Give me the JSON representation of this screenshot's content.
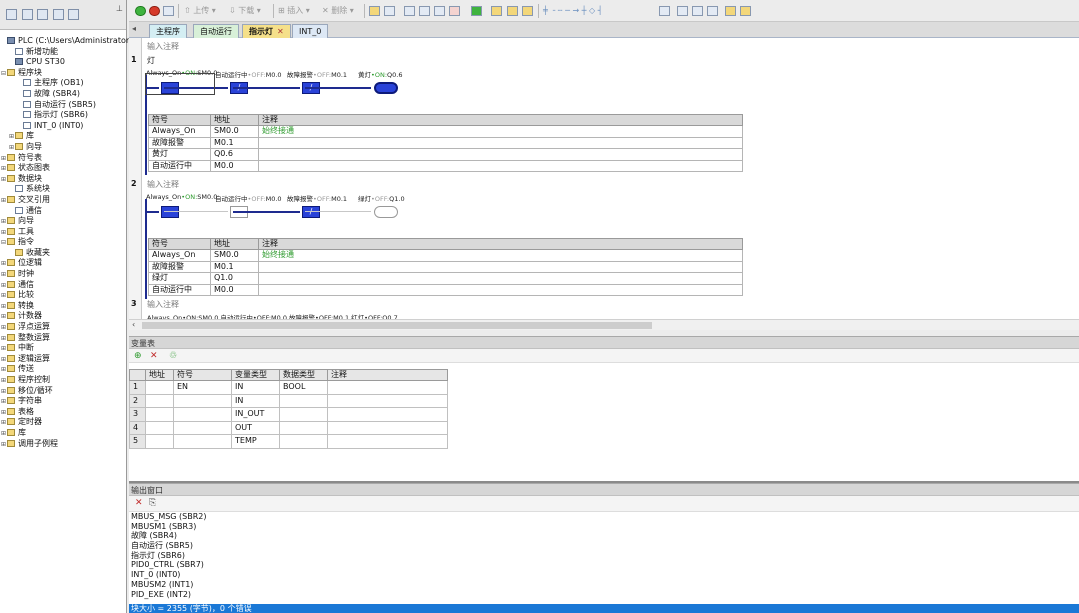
{
  "left_toolbar": {
    "first": "",
    "pin": ""
  },
  "tree": [
    {
      "indent": 0,
      "exp": "",
      "icon": "cpu",
      "label": "PLC (C:\\Users\\Administrator\\Deskt"
    },
    {
      "indent": 1,
      "exp": "",
      "icon": "doc",
      "label": "新增功能"
    },
    {
      "indent": 1,
      "exp": "",
      "icon": "cpu",
      "label": "CPU ST30"
    },
    {
      "indent": 0,
      "exp": "⊟",
      "icon": "folder",
      "label": "程序块"
    },
    {
      "indent": 2,
      "exp": "",
      "icon": "doc",
      "label": "主程序 (OB1)"
    },
    {
      "indent": 2,
      "exp": "",
      "icon": "doc",
      "label": "故障 (SBR4)"
    },
    {
      "indent": 2,
      "exp": "",
      "icon": "doc",
      "label": "自动运行 (SBR5)"
    },
    {
      "indent": 2,
      "exp": "",
      "icon": "doc",
      "label": "指示灯 (SBR6)"
    },
    {
      "indent": 2,
      "exp": "",
      "icon": "doc",
      "label": "INT_0 (INT0)"
    },
    {
      "indent": 1,
      "exp": "⊞",
      "icon": "folder",
      "label": "库"
    },
    {
      "indent": 1,
      "exp": "⊞",
      "icon": "folder",
      "label": "向导"
    },
    {
      "indent": 0,
      "exp": "⊞",
      "icon": "folder",
      "label": "符号表"
    },
    {
      "indent": 0,
      "exp": "⊞",
      "icon": "folder",
      "label": "状态图表"
    },
    {
      "indent": 0,
      "exp": "⊞",
      "icon": "folder",
      "label": "数据块"
    },
    {
      "indent": 1,
      "exp": "",
      "icon": "doc",
      "label": "系统块"
    },
    {
      "indent": 0,
      "exp": "⊞",
      "icon": "folder",
      "label": "交叉引用"
    },
    {
      "indent": 1,
      "exp": "",
      "icon": "doc",
      "label": "通信"
    },
    {
      "indent": 0,
      "exp": "⊞",
      "icon": "folder",
      "label": "向导"
    },
    {
      "indent": 0,
      "exp": "⊞",
      "icon": "folder",
      "label": "工具"
    },
    {
      "indent": 0,
      "exp": "⊟",
      "icon": "folder",
      "label": "指令"
    },
    {
      "indent": 1,
      "exp": "",
      "icon": "folder",
      "label": "收藏夹"
    },
    {
      "indent": 0,
      "exp": "⊞",
      "icon": "folder",
      "label": "位逻辑"
    },
    {
      "indent": 0,
      "exp": "⊞",
      "icon": "folder",
      "label": "时钟"
    },
    {
      "indent": 0,
      "exp": "⊞",
      "icon": "folder",
      "label": "通信"
    },
    {
      "indent": 0,
      "exp": "⊞",
      "icon": "folder",
      "label": "比较"
    },
    {
      "indent": 0,
      "exp": "⊞",
      "icon": "folder",
      "label": "转换"
    },
    {
      "indent": 0,
      "exp": "⊞",
      "icon": "folder",
      "label": "计数器"
    },
    {
      "indent": 0,
      "exp": "⊞",
      "icon": "folder",
      "label": "浮点运算"
    },
    {
      "indent": 0,
      "exp": "⊞",
      "icon": "folder",
      "label": "整数运算"
    },
    {
      "indent": 0,
      "exp": "⊞",
      "icon": "folder",
      "label": "中断"
    },
    {
      "indent": 0,
      "exp": "⊞",
      "icon": "folder",
      "label": "逻辑运算"
    },
    {
      "indent": 0,
      "exp": "⊞",
      "icon": "folder",
      "label": "传送"
    },
    {
      "indent": 0,
      "exp": "⊞",
      "icon": "folder",
      "label": "程序控制"
    },
    {
      "indent": 0,
      "exp": "⊞",
      "icon": "folder",
      "label": "移位/循环"
    },
    {
      "indent": 0,
      "exp": "⊞",
      "icon": "folder",
      "label": "字符串"
    },
    {
      "indent": 0,
      "exp": "⊞",
      "icon": "folder",
      "label": "表格"
    },
    {
      "indent": 0,
      "exp": "⊞",
      "icon": "folder",
      "label": "定时器"
    },
    {
      "indent": 0,
      "exp": "⊞",
      "icon": "folder",
      "label": "库"
    },
    {
      "indent": 0,
      "exp": "⊞",
      "icon": "folder",
      "label": "调用子例程"
    }
  ],
  "toolbar": {
    "upload": "上传",
    "download": "下载",
    "insert": "插入",
    "delete": "删除"
  },
  "tabs": [
    {
      "label": "主程序",
      "style": "t-main"
    },
    {
      "label": "自动运行",
      "style": "t-auto"
    },
    {
      "label": "指示灯",
      "style": "t-ind",
      "close": "✕"
    },
    {
      "label": "INT_0",
      "style": "t-int"
    }
  ],
  "editor": {
    "header_comment": "输入注释",
    "networks": [
      {
        "number": "1",
        "title": "灯",
        "comment": "",
        "contacts": [
          {
            "symbol": "Always_On",
            "state": "ON",
            "addr": "SM0.0",
            "type": "NO",
            "active": true
          },
          {
            "symbol": "自动运行中",
            "state": "OFF",
            "addr": "M0.0",
            "type": "NC",
            "active": true
          },
          {
            "symbol": "故障报警",
            "state": "OFF",
            "addr": "M0.1",
            "type": "NC",
            "active": true
          },
          {
            "symbol": "黄灯",
            "state": "ON",
            "addr": "Q0.6",
            "type": "COIL",
            "active": true
          }
        ],
        "table": [
          [
            "Always_On",
            "SM0.0",
            "始终接通"
          ],
          [
            "故障报警",
            "M0.1",
            ""
          ],
          [
            "黄灯",
            "Q0.6",
            ""
          ],
          [
            "自动运行中",
            "M0.0",
            ""
          ]
        ]
      },
      {
        "number": "2",
        "title": "",
        "comment": "输入注释",
        "contacts": [
          {
            "symbol": "Always_On",
            "state": "ON",
            "addr": "SM0.0",
            "type": "NO",
            "active": true
          },
          {
            "symbol": "自动运行中",
            "state": "OFF",
            "addr": "M0.0",
            "type": "NO",
            "active": false
          },
          {
            "symbol": "故障报警",
            "state": "OFF",
            "addr": "M0.1",
            "type": "NC",
            "active": true
          },
          {
            "symbol": "绿灯",
            "state": "OFF",
            "addr": "Q1.0",
            "type": "COIL",
            "active": false
          }
        ],
        "table": [
          [
            "Always_On",
            "SM0.0",
            "始终接通"
          ],
          [
            "故障报警",
            "M0.1",
            ""
          ],
          [
            "绿灯",
            "Q1.0",
            ""
          ],
          [
            "自动运行中",
            "M0.0",
            ""
          ]
        ]
      },
      {
        "number": "3",
        "comment": "输入注释",
        "partial": "Always_On•ON:SM0.0   自动运行中•OFF:M0.0   故障报警•OFF:M0.1   红灯•OFF:Q0.7"
      }
    ],
    "table_headers": [
      "符号",
      "地址",
      "注释"
    ]
  },
  "var_panel": {
    "title": "变量表",
    "headers": [
      "",
      "地址",
      "符号",
      "变量类型",
      "数据类型",
      "注释"
    ],
    "rows": [
      [
        "1",
        "",
        "EN",
        "IN",
        "BOOL",
        ""
      ],
      [
        "2",
        "",
        "",
        "IN",
        "",
        ""
      ],
      [
        "3",
        "",
        "",
        "IN_OUT",
        "",
        ""
      ],
      [
        "4",
        "",
        "",
        "OUT",
        "",
        ""
      ],
      [
        "5",
        "",
        "",
        "TEMP",
        "",
        ""
      ]
    ]
  },
  "output_panel": {
    "title": "输出窗口",
    "lines": [
      "MBUS_MSG (SBR2)",
      "MBUSM1 (SBR3)",
      "故障 (SBR4)",
      "自动运行 (SBR5)",
      "指示灯 (SBR6)",
      "PID0_CTRL (SBR7)",
      "INT_0 (INT0)",
      "MBUSM2 (INT1)",
      "PID_EXE (INT2)"
    ],
    "status": "块大小 = 2355 (字节)，0 个错误"
  },
  "colors": {
    "contact_active": "#2a43d8",
    "rail": "#1e2b8f",
    "on_state": "#2d9a2d",
    "status_bar": "#1a78d6"
  }
}
